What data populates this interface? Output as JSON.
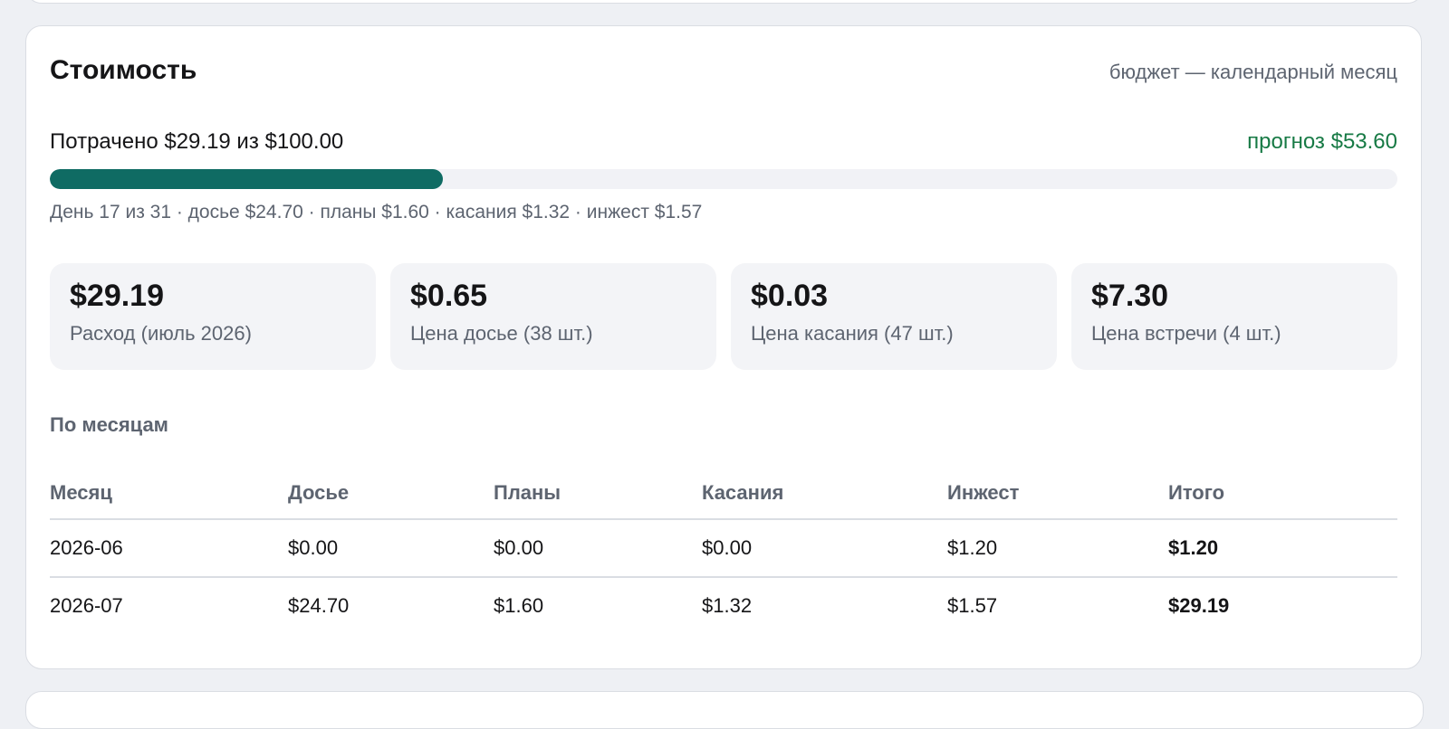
{
  "card": {
    "title": "Стоимость",
    "meta": "бюджет — календарный месяц"
  },
  "budget": {
    "spent_text": "Потрачено $29.19 из $100.00",
    "forecast_text": "прогноз $53.60",
    "progress_fraction": 0.2919,
    "breakdown_text": "День 17 из 31 · досье $24.70 · планы $1.60 · касания $1.32 · инжест $1.57"
  },
  "stats": [
    {
      "value": "$29.19",
      "label": "Расход (июль 2026)"
    },
    {
      "value": "$0.65",
      "label": "Цена досье (38 шт.)"
    },
    {
      "value": "$0.03",
      "label": "Цена касания (47 шт.)"
    },
    {
      "value": "$7.30",
      "label": "Цена встречи (4 шт.)"
    }
  ],
  "monthly": {
    "title": "По месяцам",
    "columns": [
      "Месяц",
      "Досье",
      "Планы",
      "Касания",
      "Инжест",
      "Итого"
    ],
    "rows": [
      [
        "2026-06",
        "$0.00",
        "$0.00",
        "$0.00",
        "$1.20",
        "$1.20"
      ],
      [
        "2026-07",
        "$24.70",
        "$1.60",
        "$1.32",
        "$1.57",
        "$29.19"
      ]
    ]
  },
  "colors": {
    "progress_fill": "#0f6b63",
    "forecast": "#177a45",
    "background": "#eef0f4"
  }
}
